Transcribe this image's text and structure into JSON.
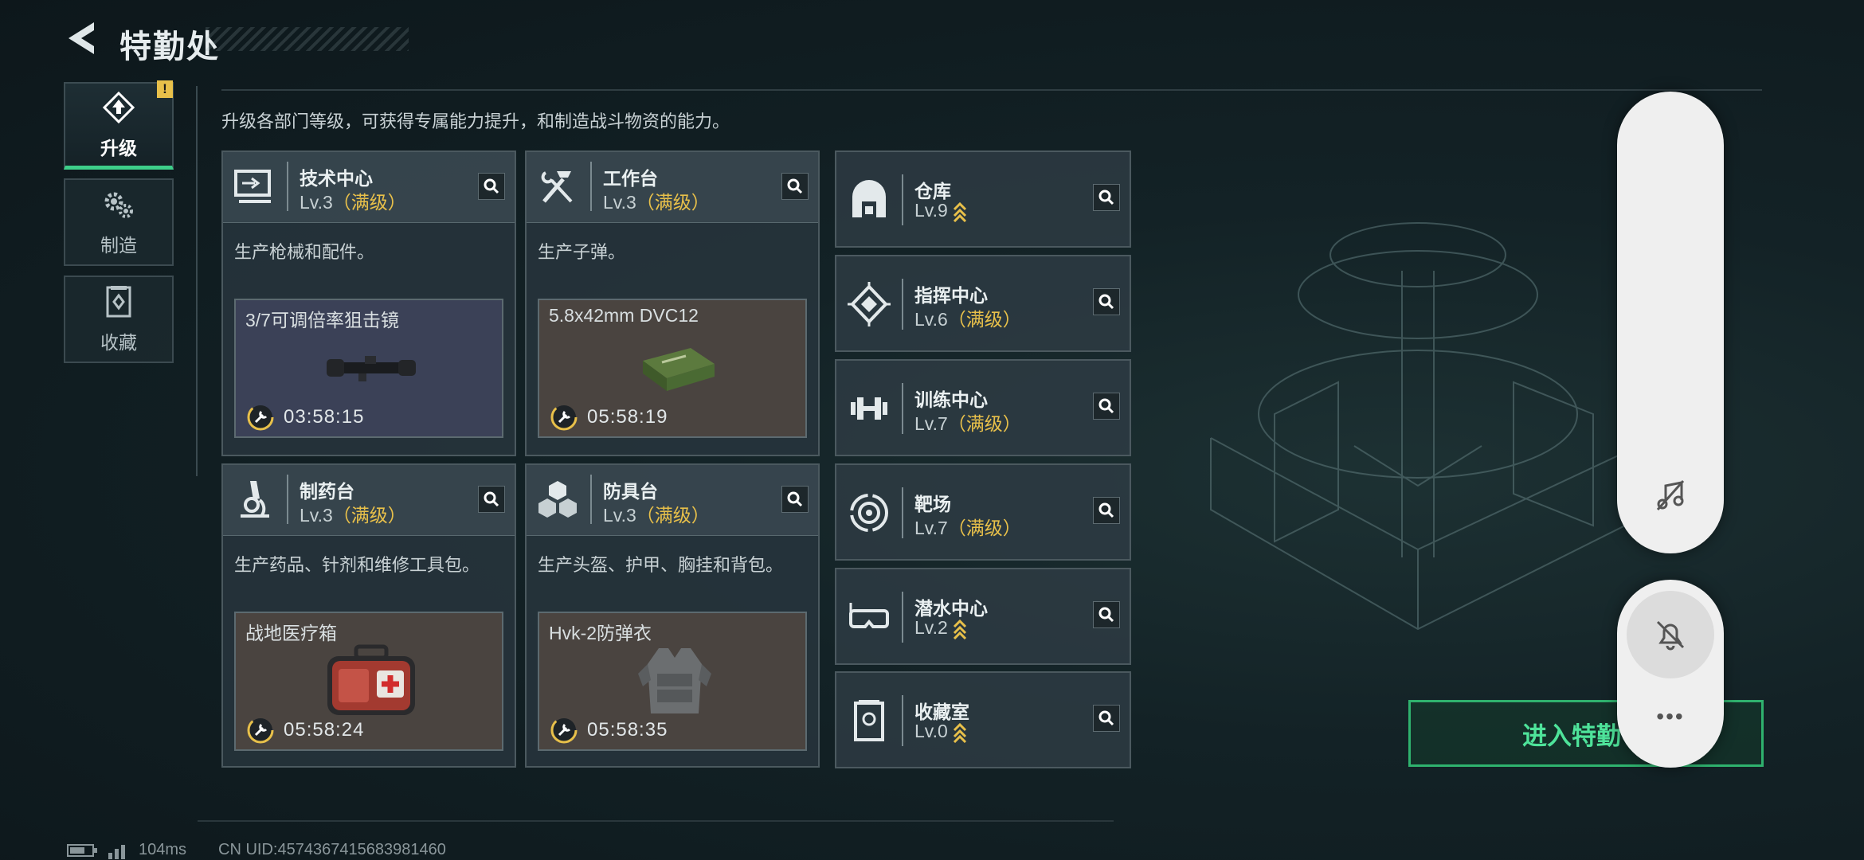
{
  "header": {
    "title": "特勤处"
  },
  "nav": [
    {
      "label": "升级",
      "active": true,
      "icon": "upgrade-icon",
      "badge": "!"
    },
    {
      "label": "制造",
      "active": false,
      "icon": "gears-icon"
    },
    {
      "label": "收藏",
      "active": false,
      "icon": "collection-icon"
    }
  ],
  "description": "升级各部门等级，可获得专属能力提升，和制造战斗物资的能力。",
  "cards": [
    {
      "name": "技术中心",
      "level": "Lv.3",
      "max": "（满级）",
      "icon": "computer-icon",
      "desc": "生产枪械和配件。",
      "product": {
        "name": "3/7可调倍率狙击镜",
        "timer": "03:58:15",
        "bg": "#3b4157"
      }
    },
    {
      "name": "工作台",
      "level": "Lv.3",
      "max": "（满级）",
      "icon": "tools-icon",
      "desc": "生产子弹。",
      "product": {
        "name": "5.8x42mm DVC12",
        "timer": "05:58:19",
        "bg": "#4a4440"
      }
    },
    {
      "name": "制药台",
      "level": "Lv.3",
      "max": "（满级）",
      "icon": "microscope-icon",
      "desc": "生产药品、针剂和维修工具包。",
      "product": {
        "name": "战地医疗箱",
        "timer": "05:58:24",
        "bg": "#4a4440"
      }
    },
    {
      "name": "防具台",
      "level": "Lv.3",
      "max": "（满级）",
      "icon": "armor-blocks-icon",
      "desc": "生产头盔、护甲、胸挂和背包。",
      "product": {
        "name": "Hvk-2防弹衣",
        "timer": "05:58:35",
        "bg": "#4a4440"
      }
    }
  ],
  "small_cards": [
    {
      "name": "仓库",
      "level": "Lv.9",
      "max": "",
      "upgradable": true,
      "icon": "warehouse-icon"
    },
    {
      "name": "指挥中心",
      "level": "Lv.6",
      "max": "（满级）",
      "upgradable": false,
      "icon": "chip-icon"
    },
    {
      "name": "训练中心",
      "level": "Lv.7",
      "max": "（满级）",
      "upgradable": false,
      "icon": "dumbbell-icon"
    },
    {
      "name": "靶场",
      "level": "Lv.7",
      "max": "（满级）",
      "upgradable": false,
      "icon": "target-icon"
    },
    {
      "name": "潜水中心",
      "level": "Lv.2",
      "max": "",
      "upgradable": true,
      "icon": "diving-mask-icon"
    },
    {
      "name": "收藏室",
      "level": "Lv.0",
      "max": "",
      "upgradable": true,
      "icon": "display-case-icon"
    }
  ],
  "enter_button": "进入特勤",
  "overlay": {
    "more_label": "•••"
  },
  "status": {
    "ping": "104ms",
    "uid": "CN UID:4574367415683981460"
  },
  "colors": {
    "accent_green": "#3ecf8a",
    "max_level_gold": "#e8c04a"
  }
}
